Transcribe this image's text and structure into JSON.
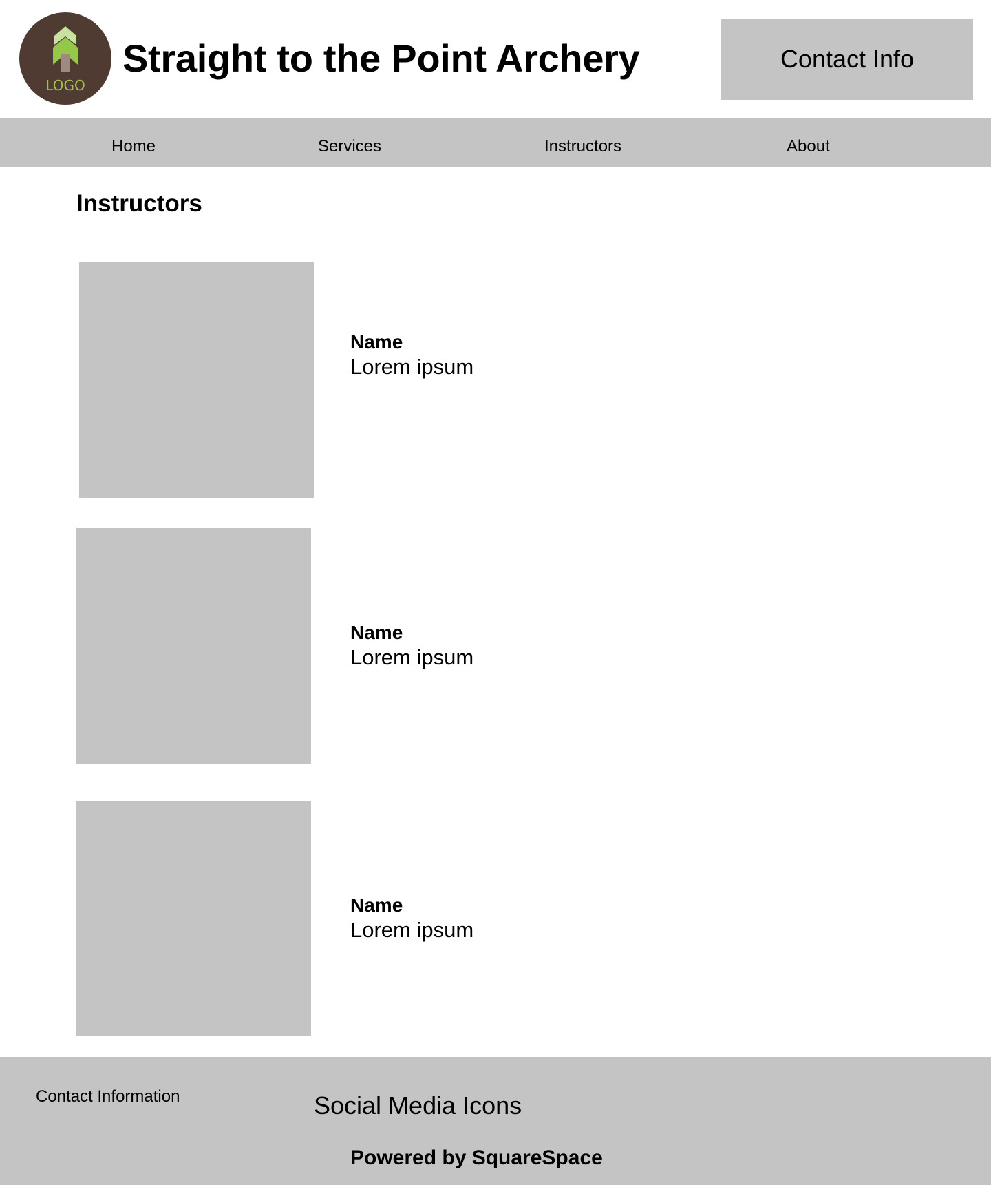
{
  "header": {
    "logo_text": "LOGO",
    "site_title": "Straight to the Point Archery",
    "contact_button_label": "Contact Info"
  },
  "nav": {
    "items": [
      {
        "label": "Home"
      },
      {
        "label": "Services"
      },
      {
        "label": "Instructors"
      },
      {
        "label": "About"
      }
    ]
  },
  "main": {
    "page_title": "Instructors",
    "instructors": [
      {
        "name": "Name",
        "description": "Lorem ipsum"
      },
      {
        "name": "Name",
        "description": "Lorem ipsum"
      },
      {
        "name": "Name",
        "description": "Lorem ipsum"
      }
    ]
  },
  "footer": {
    "contact_information": "Contact Information",
    "social_media": "Social Media Icons",
    "powered_by": "Powered by SquareSpace"
  },
  "colors": {
    "logo_background": "#4f3b32",
    "logo_arrow_light": "#c8e2a0",
    "logo_arrow": "#94c84a",
    "logo_shaft": "#9c8b7e",
    "placeholder_gray": "#c4c4c4"
  }
}
